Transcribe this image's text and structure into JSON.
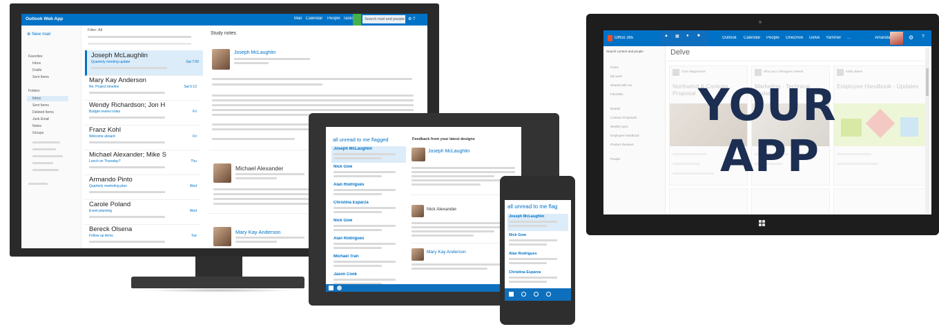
{
  "monitor": {
    "brand": "Outlook Web App",
    "nav": [
      "Mail",
      "Calendar",
      "People",
      "Tasks"
    ],
    "search_placeholder": "Search mail and people",
    "new_mail": "New mail",
    "folders": [
      "Favorites",
      "Inbox",
      "Drafts",
      "Sent Items",
      "Folders",
      "Inbox",
      "Sent Items",
      "Deleted Items",
      "Junk Email",
      "Notes",
      "Groups"
    ],
    "list_header": "Filter: All",
    "list_items": [
      {
        "name": "Joseph McLaughlin",
        "subject": "Quarterly meeting update",
        "time": "Sat 7:00",
        "selected": true
      },
      {
        "name": "Mary Kay Anderson",
        "subject": "Re: Project timeline",
        "time": "Sat 5:12",
        "selected": false
      },
      {
        "name": "Wendy Richardson; Jon H",
        "subject": "Budget review notes",
        "time": "Fri",
        "selected": false
      },
      {
        "name": "Franz Kohl",
        "subject": "Welcome aboard",
        "time": "Fri",
        "selected": false
      },
      {
        "name": "Michael Alexander; Mike S",
        "subject": "Lunch on Thursday?",
        "time": "Thu",
        "selected": false
      },
      {
        "name": "Armando Pinto",
        "subject": "Quarterly marketing plan",
        "time": "Wed",
        "selected": false
      },
      {
        "name": "Carole Poland",
        "subject": "Event planning",
        "time": "Wed",
        "selected": false
      },
      {
        "name": "Bereck Olsena",
        "subject": "Follow up items",
        "time": "Tue",
        "selected": false
      }
    ],
    "reading_title": "Study notes",
    "reading_sender": "Joseph McLaughlin",
    "reading_reply1": "Michael Alexander",
    "reading_reply2": "Mary Kay Anderson"
  },
  "tablet": {
    "filter": "all  unread  to me  flagged",
    "header": "Feedback from your latest designs",
    "items": [
      {
        "name": "Joseph McLaughlin"
      },
      {
        "name": "Nick Gow"
      },
      {
        "name": "Alan Rodrigues"
      },
      {
        "name": "Christina Esparza"
      },
      {
        "name": "Nick Gow"
      },
      {
        "name": "Alan Rodrigues"
      },
      {
        "name": "Michael Tran"
      },
      {
        "name": "Jason Cook"
      }
    ],
    "sender": "Joseph McLaughlin",
    "reply1": "Nick Alexander",
    "reply2": "Mary Kay Anderson"
  },
  "phone": {
    "filter": "all  unread  to me  flag",
    "items": [
      "Joseph McLaughlin",
      "Nick Gow",
      "Alan Rodrigues",
      "Christina Esparza"
    ]
  },
  "right_tablet": {
    "brand": "Office 365",
    "nav": [
      "Outlook",
      "Calendar",
      "People",
      "OneDrive",
      "Delve",
      "Yammer",
      "..."
    ],
    "user": "Amanda",
    "search_placeholder": "Search content and people",
    "app_title": "Delve",
    "sidebar": [
      "Home",
      "My work",
      "Shared with me",
      "Favorites",
      "Boards",
      "Contoso Proposals",
      "Weekly Sync",
      "Employee Handbook",
      "Product Reviews",
      "People"
    ],
    "cards": [
      {
        "title": "Northwind & Contoso Proposal",
        "author": "Chris Magnusson"
      },
      {
        "title": "Marketing - Technical Update",
        "author": "Who your colleagues viewed"
      },
      {
        "title": "Employee Handbook - Updates",
        "author": "Kathy Bates"
      }
    ]
  },
  "overlay": {
    "line1": "YOUR",
    "line2": "APP"
  }
}
